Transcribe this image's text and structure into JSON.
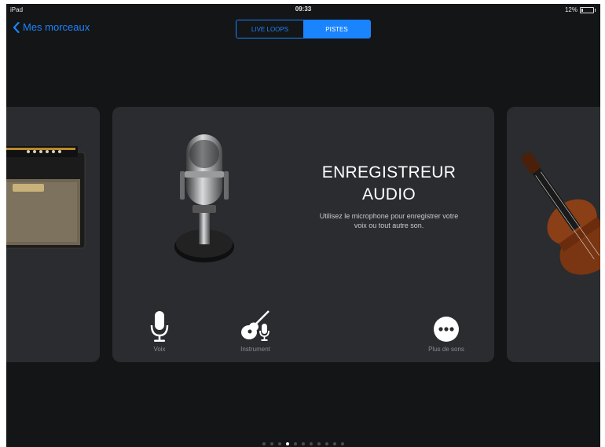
{
  "status_bar": {
    "device": "iPad",
    "time": "09:33",
    "battery": "12%"
  },
  "nav": {
    "back_label": "Mes morceaux"
  },
  "tabs": [
    {
      "label": "LIVE LOOPS",
      "active": false
    },
    {
      "label": "PISTES",
      "active": true
    }
  ],
  "card": {
    "title_line1": "ENREGISTREUR",
    "title_line2": "AUDIO",
    "description_line1": "Utilisez le microphone pour enregistrer votre",
    "description_line2": "voix ou tout autre son."
  },
  "options": [
    {
      "label": "Voix",
      "icon": "microphone-icon"
    },
    {
      "label": "Instrument",
      "icon": "guitar-microphone-icon"
    },
    {
      "label": "Plus de sons",
      "icon": "more-icon"
    }
  ],
  "pagination": {
    "count": 11,
    "active_index": 3
  },
  "colors": {
    "accent": "#1a84ff",
    "background": "#141516",
    "card": "#2a2c2f"
  }
}
